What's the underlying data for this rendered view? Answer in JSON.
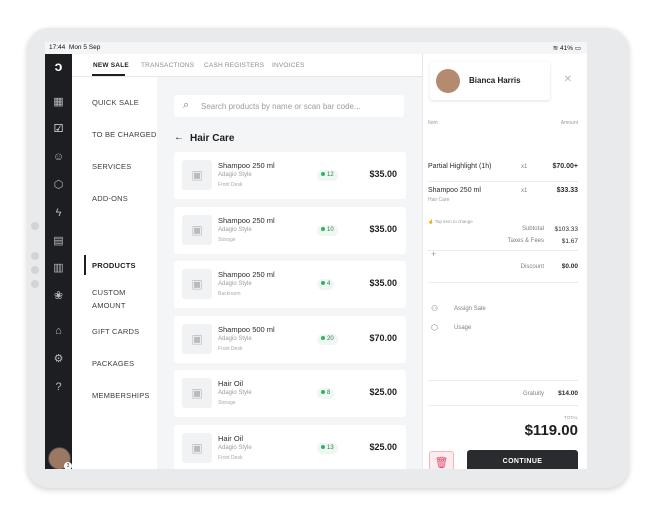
{
  "status": {
    "time": "17:44",
    "date": "Mon 5 Sep",
    "wifi_icon": "wifi-icon",
    "battery": "41%"
  },
  "nav": {
    "tabs": [
      {
        "label": "NEW SALE",
        "active": true
      },
      {
        "label": "TRANSACTIONS"
      },
      {
        "label": "CASH REGISTERS"
      },
      {
        "label": "INVOICES"
      }
    ]
  },
  "categories": [
    "QUICK SALE",
    "TO BE CHARGED",
    "SERVICES",
    "ADD-ONS",
    "PRODUCTS",
    "CUSTOM",
    "AMOUNT",
    "GIFT CARDS",
    "PACKAGES",
    "MEMBERSHIPS"
  ],
  "active_category": "PRODUCTS",
  "search": {
    "placeholder": "Search products by name or scan bar code..."
  },
  "section_title": "Hair Care",
  "products": [
    {
      "name": "Shampoo 250 ml",
      "style": "Adagio Style",
      "location": "Front Desk",
      "stock": "12",
      "price": "$35.00"
    },
    {
      "name": "Shampoo 250 ml",
      "style": "Adagio Style",
      "location": "Storage",
      "stock": "10",
      "price": "$35.00"
    },
    {
      "name": "Shampoo 250 ml",
      "style": "Adagio Style",
      "location": "Backroom",
      "stock": "4",
      "price": "$35.00"
    },
    {
      "name": "Shampoo 500 ml",
      "style": "Adagio Style",
      "location": "Front Desk",
      "stock": "20",
      "price": "$70.00"
    },
    {
      "name": "Hair Oil",
      "style": "Adagio Style",
      "location": "Storage",
      "stock": "8",
      "price": "$25.00"
    },
    {
      "name": "Hair Oil",
      "style": "Adagio Style",
      "location": "Front Desk",
      "stock": "13",
      "price": "$25.00"
    }
  ],
  "cart": {
    "customer": "Bianca Harris",
    "col_item": "Item",
    "col_amount": "Amount",
    "items": [
      {
        "name": "Partial Highlight (1h)",
        "qty": "x1",
        "amount": "$70.00+",
        "sub": ""
      },
      {
        "name": "Shampoo 250 ml",
        "qty": "x1",
        "amount": "$33.33",
        "sub": "Hair Care"
      }
    ],
    "hint": "Tap item to change",
    "subtotal_label": "Subtotal",
    "subtotal": "$103.33",
    "taxes_label": "Taxes & Fees",
    "taxes": "$1.67",
    "discount_label": "Discount",
    "discount": "$0.00",
    "assign_sale": "Assign Sale",
    "usage": "Usage",
    "gratuity_label": "Gratuity",
    "gratuity": "$14.00",
    "total_label": "TOTAL",
    "total": "$119.00",
    "continue_label": "CONTINUE"
  }
}
